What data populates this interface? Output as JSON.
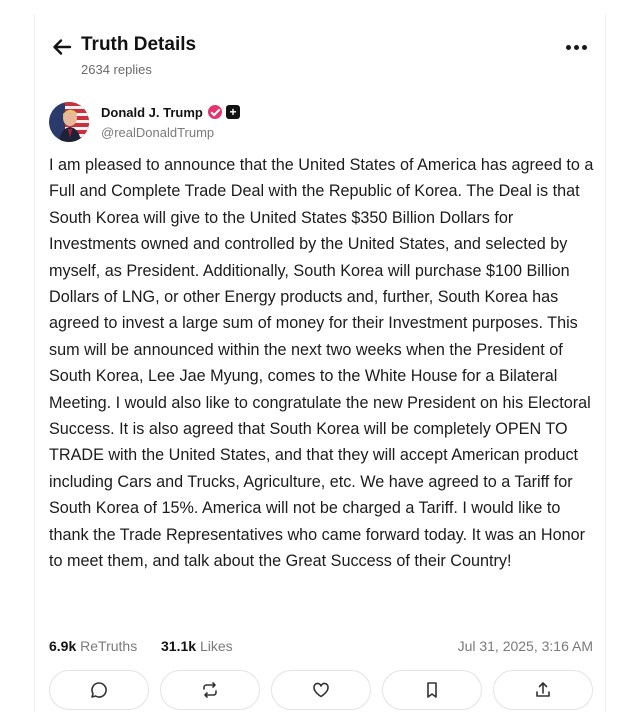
{
  "header": {
    "title": "Truth Details",
    "replies": "2634 replies"
  },
  "post": {
    "author_name": "Donald J. Trump",
    "author_handle": "@realDonaldTrump",
    "body": "I am pleased to announce that the United States of America has agreed to a Full and Complete Trade Deal with the Republic of Korea. The Deal is that South Korea will give to the United States $350 Billion Dollars for Investments owned and controlled by the United States, and selected by myself, as President. Additionally, South Korea will purchase $100 Billion Dollars of LNG, or other Energy products and, further, South Korea has agreed to invest a large sum of money for their Investment purposes. This sum will be announced within the next two weeks when the President of South Korea, Lee Jae Myung, comes to the White House for a Bilateral Meeting. I would also like to congratulate the new President on his Electoral Success. It is also agreed that South Korea will be completely OPEN TO TRADE with the United States, and that they will accept American product including Cars and Trucks, Agriculture, etc. We have agreed to a Tariff for South Korea of 15%. America will not be charged a Tariff. I would like to thank the Trade Representatives who came forward today. It was an Honor to meet them, and talk about the Great Success of their Country!",
    "retruths_count": "6.9k",
    "retruths_label": "ReTruths",
    "likes_count": "31.1k",
    "likes_label": "Likes",
    "timestamp": "Jul 31, 2025, 3:16 AM"
  },
  "icons": {
    "back": "arrow-left-icon",
    "more": "more-horizontal-icon",
    "verified": "verified-badge-icon",
    "plus": "plus-badge-icon",
    "reply": "reply-icon",
    "retruth": "retruth-icon",
    "like": "heart-icon",
    "bookmark": "bookmark-icon",
    "share": "share-icon"
  },
  "colors": {
    "verified_badge": "#e2356f",
    "text_primary": "#1c1c1c",
    "text_secondary": "#7a7a7a",
    "border": "#e3e3e3"
  }
}
